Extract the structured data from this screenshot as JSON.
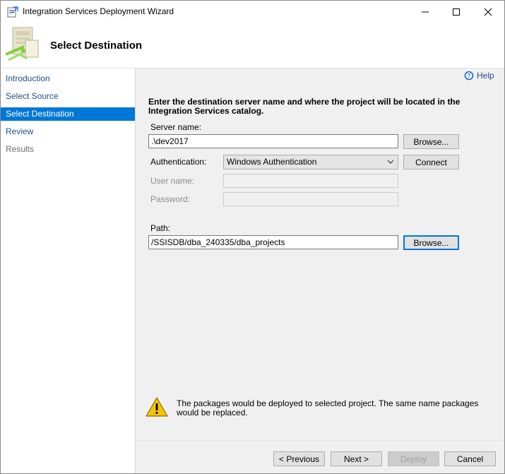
{
  "window": {
    "title": "Integration Services Deployment Wizard",
    "controls": [
      "minimize",
      "maximize",
      "close"
    ]
  },
  "header": {
    "title": "Select Destination"
  },
  "sidebar": {
    "items": [
      {
        "label": "Introduction",
        "state": "normal"
      },
      {
        "label": "Select Source",
        "state": "normal"
      },
      {
        "label": "Select Destination",
        "state": "active"
      },
      {
        "label": "Review",
        "state": "normal"
      },
      {
        "label": "Results",
        "state": "disabled"
      }
    ]
  },
  "help": {
    "label": "Help"
  },
  "main": {
    "instruction": "Enter the destination server name and where the project will be located in the Integration Services catalog.",
    "server_name": {
      "label": "Server name:",
      "value": ".\\dev2017",
      "browse_label": "Browse..."
    },
    "authentication": {
      "label": "Authentication:",
      "selected": "Windows Authentication",
      "connect_label": "Connect"
    },
    "user_name": {
      "label": "User name:",
      "value": ""
    },
    "password": {
      "label": "Password:",
      "value": ""
    },
    "path": {
      "label": "Path:",
      "value": "/SSISDB/dba_240335/dba_projects",
      "browse_label": "Browse..."
    }
  },
  "warning": {
    "text": "The packages would be deployed to selected project. The same name packages would be replaced."
  },
  "footer": {
    "previous_label": "< Previous",
    "next_label": "Next >",
    "deploy_label": "Deploy",
    "cancel_label": "Cancel"
  },
  "colors": {
    "accent": "#0078d7",
    "link": "#1f4f8f",
    "warning": "#f5c400"
  }
}
